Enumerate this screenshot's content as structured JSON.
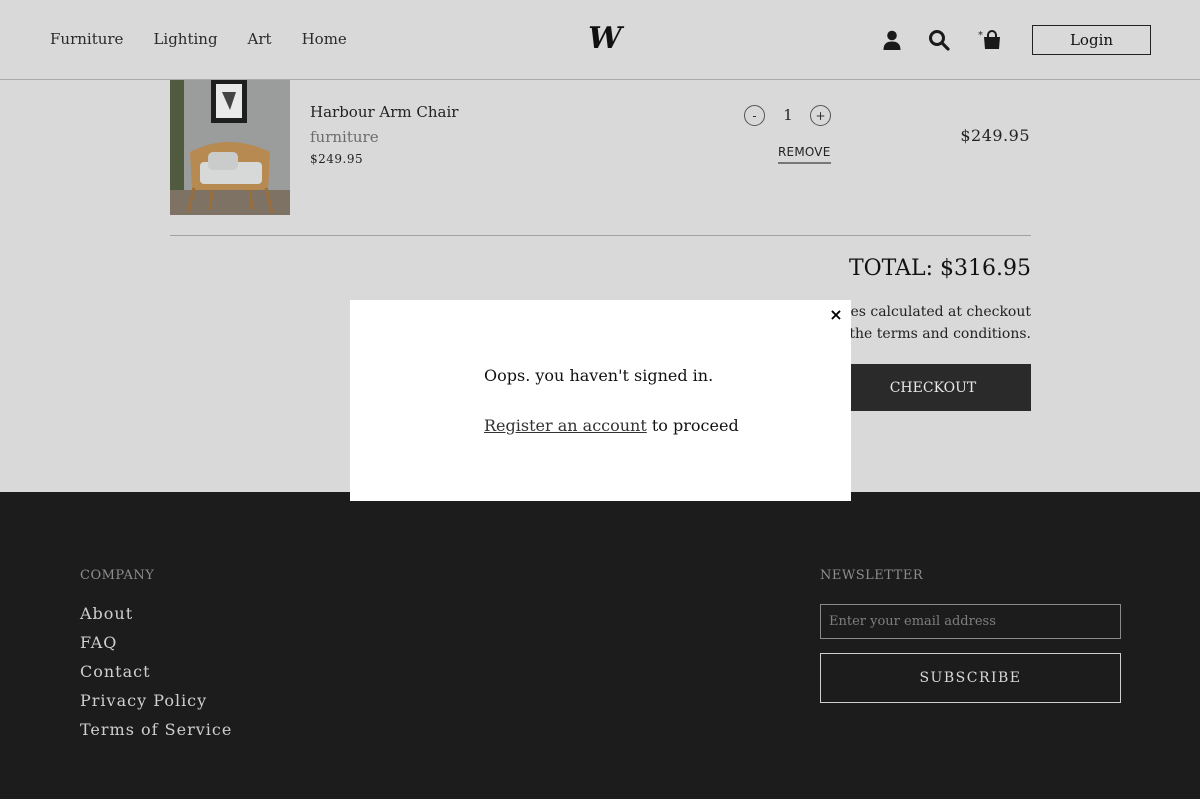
{
  "header": {
    "nav": [
      "Furniture",
      "Lighting",
      "Art",
      "Home"
    ],
    "logo_text": "W",
    "icons": [
      "user-icon",
      "search-icon",
      "shopping-bag-icon"
    ],
    "bag_count": "*",
    "login_label": "Login"
  },
  "cart": {
    "item": {
      "name": "Harbour Arm Chair",
      "category": "furniture",
      "price": "$249.95",
      "quantity": "1",
      "minus_label": "-",
      "plus_label": "+",
      "remove_label": "REMOVE",
      "line_total": "$249.95"
    },
    "total": "TOTAL: $316.95",
    "notice_line1": "Shipping & taxes calculated at checkout",
    "notice_line2": "I agree with the terms and conditions.",
    "checkout_label": "CHECKOUT"
  },
  "modal": {
    "close_label": "×",
    "message": "Oops. you haven't signed in.",
    "register_link": "Register an account",
    "proceed_text": " to proceed"
  },
  "footer": {
    "company_heading": "COMPANY",
    "company_links": [
      "About",
      "FAQ",
      "Contact",
      "Privacy Policy",
      "Terms of Service"
    ],
    "newsletter_heading": "NEWSLETTER",
    "email_placeholder": "Enter your email address",
    "subscribe_label": "SUBSCRIBE"
  },
  "colors": {
    "page_bg": "#d9d9d9",
    "footer_bg": "#1c1c1c",
    "button_dark": "#2a2a2a",
    "modal_bg": "#ffffff"
  }
}
